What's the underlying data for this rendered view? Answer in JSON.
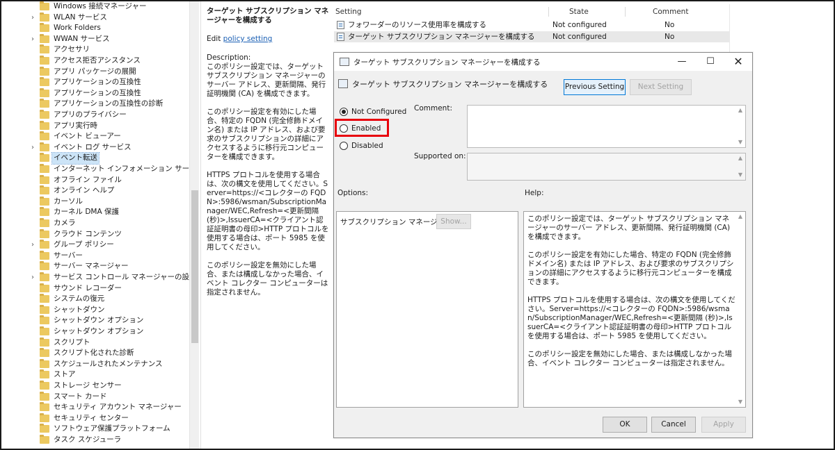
{
  "tree": {
    "items": [
      {
        "label": "Windows 接続マネージャー",
        "expander": false
      },
      {
        "label": "WLAN サービス",
        "expander": true
      },
      {
        "label": "Work Folders",
        "expander": false
      },
      {
        "label": "WWAN サービス",
        "expander": true
      },
      {
        "label": "アクセサリ",
        "expander": false
      },
      {
        "label": "アクセス拒否アシスタンス",
        "expander": false
      },
      {
        "label": "アプリ パッケージの展開",
        "expander": false
      },
      {
        "label": "アプリケーションの互換性",
        "expander": false
      },
      {
        "label": "アプリケーションの互換性",
        "expander": false
      },
      {
        "label": "アプリケーションの互換性の診断",
        "expander": false
      },
      {
        "label": "アプリのプライバシー",
        "expander": false
      },
      {
        "label": "アプリ実行時",
        "expander": false
      },
      {
        "label": "イベント ビューアー",
        "expander": false
      },
      {
        "label": "イベント ログ サービス",
        "expander": true
      },
      {
        "label": "イベント転送",
        "expander": false,
        "selected": true
      },
      {
        "label": "インターネット インフォメーション サービス",
        "expander": false
      },
      {
        "label": "オフライン ファイル",
        "expander": false
      },
      {
        "label": "オンライン ヘルプ",
        "expander": false
      },
      {
        "label": "カーソル",
        "expander": false
      },
      {
        "label": "カーネル DMA 保護",
        "expander": false
      },
      {
        "label": "カメラ",
        "expander": false
      },
      {
        "label": "クラウド コンテンツ",
        "expander": false
      },
      {
        "label": "グループ ポリシー",
        "expander": true
      },
      {
        "label": "サーバー",
        "expander": false
      },
      {
        "label": "サーバー マネージャー",
        "expander": false
      },
      {
        "label": "サービス コントロール マネージャーの設定",
        "expander": true
      },
      {
        "label": "サウンド レコーダー",
        "expander": false
      },
      {
        "label": "システムの復元",
        "expander": false
      },
      {
        "label": "シャットダウン",
        "expander": false
      },
      {
        "label": "シャットダウン オプション",
        "expander": false
      },
      {
        "label": "シャットダウン オプション",
        "expander": false
      },
      {
        "label": "スクリプト",
        "expander": false
      },
      {
        "label": "スクリプト化された診断",
        "expander": false
      },
      {
        "label": "スケジュールされたメンテナンス",
        "expander": false
      },
      {
        "label": "ストア",
        "expander": false
      },
      {
        "label": "ストレージ センサー",
        "expander": false
      },
      {
        "label": "スマート カード",
        "expander": false
      },
      {
        "label": "セキュリティ アカウント マネージャー",
        "expander": false
      },
      {
        "label": "セキュリティ センター",
        "expander": false
      },
      {
        "label": "ソフトウェア保護プラットフォーム",
        "expander": false
      },
      {
        "label": "タスク スケジューラ",
        "expander": false
      }
    ]
  },
  "description": {
    "title": "ターゲット サブスクリプション マネージャーを構成する",
    "edit_prefix": "Edit ",
    "edit_link": "policy setting ",
    "heading": "Description:",
    "para1": "このポリシー設定では、ターゲット サブスクリプション マネージャーのサーバー アドレス、更新間隔、発行証明機関 (CA) を構成できます。",
    "para2": "このポリシー設定を有効にした場合、特定の FQDN (完全修飾ドメイン名) または IP アドレス、および要求のサブスクリプションの詳細にアクセスするように移行元コンピューターを構成できます。",
    "para3": "HTTPS プロトコルを使用する場合は、次の構文を使用してください。Server=https://<コレクターの FQDN>:5986/wsman/SubscriptionManager/WEC,Refresh=<更新間隔 (秒)>,IssuerCA=<クライアント認証証明書の母印>HTTP プロトコルを使用する場合は、ポート 5985 を使用してください。",
    "para4": "このポリシー設定を無効にした場合、または構成しなかった場合、イベント コレクター コンピューターは指定されません。"
  },
  "settings_list": {
    "columns": [
      "Setting",
      "State",
      "Comment"
    ],
    "rows": [
      {
        "setting": "フォワーダーのリソース使用率を構成する",
        "state": "Not configured",
        "comment": "No"
      },
      {
        "setting": "ターゲット サブスクリプション マネージャーを構成する",
        "state": "Not configured",
        "comment": "No"
      }
    ]
  },
  "dialog": {
    "title": "ターゲット サブスクリプション マネージャーを構成する",
    "subtitle": "ターゲット サブスクリプション マネージャーを構成する",
    "prev_button": "Previous Setting",
    "next_button": "Next Setting",
    "radio_not_configured": "Not Configured",
    "radio_enabled": "Enabled",
    "radio_disabled": "Disabled",
    "selected_option": "Not Configured",
    "comment_label": "Comment:",
    "supported_label": "Supported on:",
    "options_label": "Options:",
    "help_label": "Help:",
    "option_field_label": "サブスクリプション マネージャー",
    "show_button": "Show...",
    "help_para1": "このポリシー設定では、ターゲット サブスクリプション マネージャーのサーバー アドレス、更新間隔、発行証明機関 (CA) を構成できます。",
    "help_para2": "このポリシー設定を有効にした場合、特定の FQDN (完全修飾ドメイン名) または IP アドレス、および要求のサブスクリプションの詳細にアクセスするように移行元コンピューターを構成できます。",
    "help_para3": "HTTPS プロトコルを使用する場合は、次の構文を使用してください。Server=https://<コレクターの FQDN>:5986/wsman/SubscriptionManager/WEC,Refresh=<更新間隔 (秒)>,IssuerCA=<クライアント認証証明書の母印>HTTP プロトコルを使用する場合は、ポート 5985 を使用してください。",
    "help_para4": "このポリシー設定を無効にした場合、または構成しなかった場合、イベント コレクター コンピューターは指定されません。",
    "ok_button": "OK",
    "cancel_button": "Cancel",
    "apply_button": "Apply"
  },
  "colors": {
    "highlight": "#e8000b",
    "link": "#1a5fb4",
    "focus": "#0078d7"
  }
}
